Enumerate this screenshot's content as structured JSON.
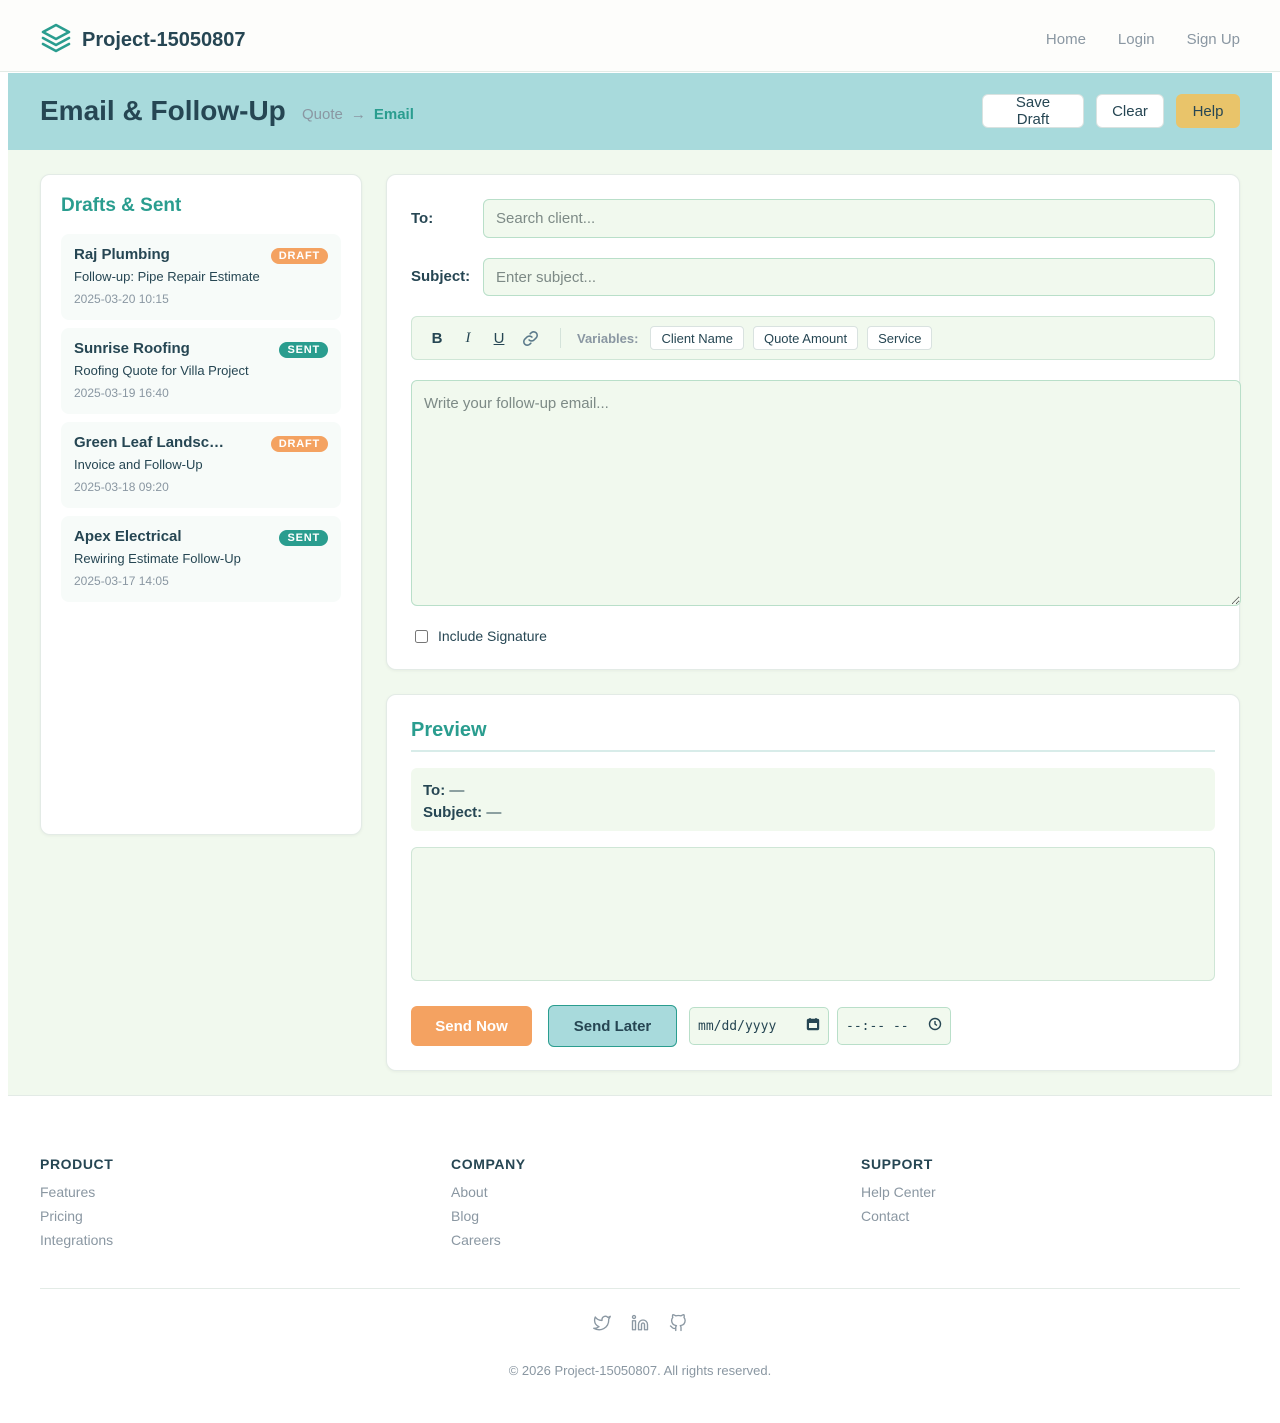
{
  "brand": {
    "name": "Project-15050807"
  },
  "nav": {
    "home": "Home",
    "login": "Login",
    "signup": "Sign Up"
  },
  "header": {
    "title": "Email & Follow-Up",
    "breadcrumb": [
      "Quote",
      "→",
      "Email"
    ],
    "actions": {
      "save_draft": "Save Draft",
      "clear": "Clear",
      "help": "Help"
    }
  },
  "sidebar": {
    "title": "Drafts & Sent",
    "items": [
      {
        "client": "Raj Plumbing",
        "subject": "Follow-up: Pipe Repair Estimate",
        "time": "2025-03-20 10:15",
        "status": "DRAFT"
      },
      {
        "client": "Sunrise Roofing",
        "subject": "Roofing Quote for Villa Project",
        "time": "2025-03-19 16:40",
        "status": "SENT"
      },
      {
        "client": "Green Leaf Landscaping",
        "subject": "Invoice and Follow-Up",
        "time": "2025-03-18 09:20",
        "status": "DRAFT"
      },
      {
        "client": "Apex Electrical",
        "subject": "Rewiring Estimate Follow-Up",
        "time": "2025-03-17 14:05",
        "status": "SENT"
      }
    ]
  },
  "compose": {
    "to_label": "To:",
    "to_placeholder": "Search client...",
    "subject_label": "Subject:",
    "subject_placeholder": "Enter subject...",
    "toolbar": {
      "bold": "B",
      "italic": "I",
      "underline": "U",
      "link_icon": "link-icon",
      "variables_label": "Variables:",
      "variables": [
        "Client Name",
        "Quote Amount",
        "Service"
      ]
    },
    "body_placeholder": "Write your follow-up email...",
    "signature_label": "Include Signature"
  },
  "preview": {
    "title": "Preview",
    "to_label": "To:",
    "to_value": "—",
    "subject_label": "Subject:",
    "subject_value": "—",
    "send_now": "Send Now",
    "send_later": "Send Later",
    "date_placeholder": "mm/dd/yyyy",
    "time_placeholder": "--:-- --"
  },
  "footer": {
    "columns": [
      {
        "title": "PRODUCT",
        "links": [
          "Features",
          "Pricing",
          "Integrations"
        ]
      },
      {
        "title": "COMPANY",
        "links": [
          "About",
          "Blog",
          "Careers"
        ]
      },
      {
        "title": "SUPPORT",
        "links": [
          "Help Center",
          "Contact"
        ]
      }
    ],
    "social_icons": [
      "twitter-icon",
      "linkedin-icon",
      "github-icon"
    ],
    "copyright": "© 2026 Project-15050807. All rights reserved."
  },
  "colors": {
    "primary": "#2a9d8f",
    "dark": "#264653",
    "accent_orange": "#f4a261",
    "accent_yellow": "#e9c46a",
    "header_band": "#a8dadc",
    "main_bg": "#f1f9ee"
  }
}
